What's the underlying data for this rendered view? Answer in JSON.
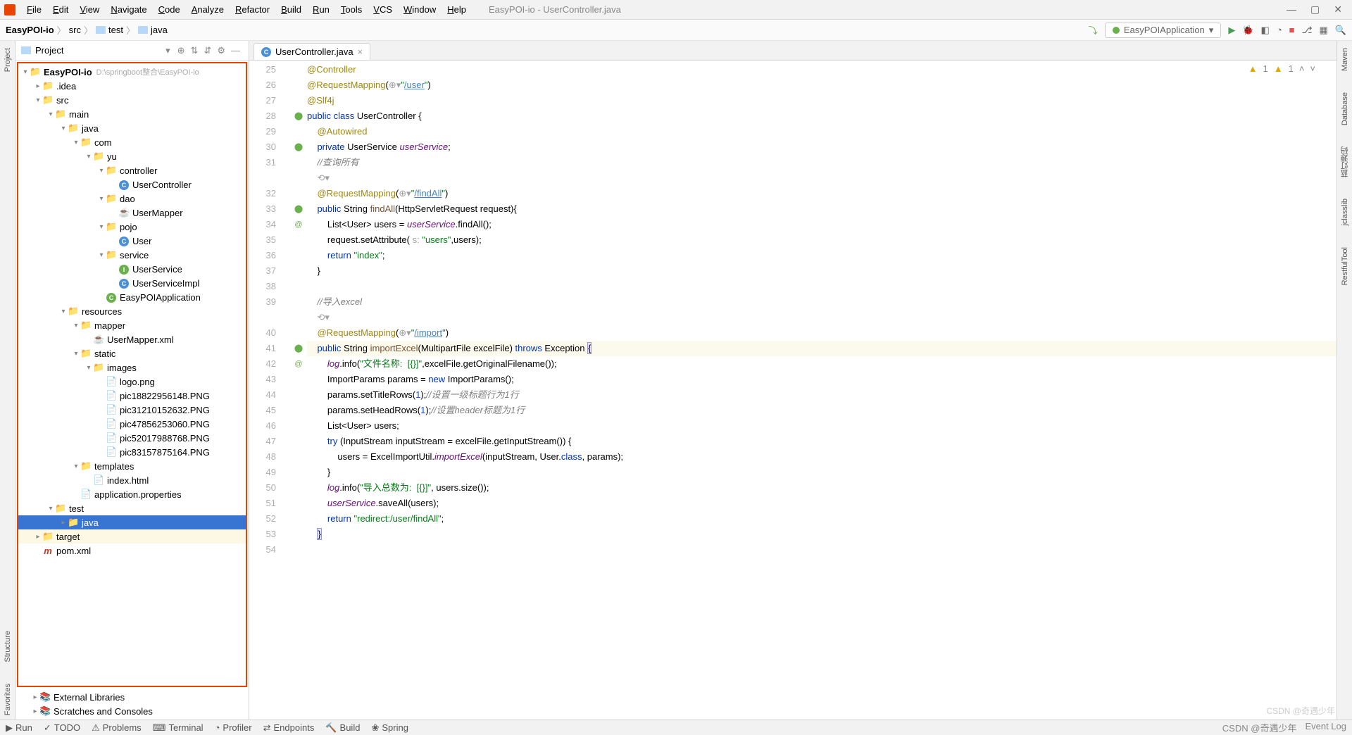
{
  "window_title": "EasyPOI-io - UserController.java",
  "menu": [
    "File",
    "Edit",
    "View",
    "Navigate",
    "Code",
    "Analyze",
    "Refactor",
    "Build",
    "Run",
    "Tools",
    "VCS",
    "Window",
    "Help"
  ],
  "breadcrumb": [
    "EasyPOI-io",
    "src",
    "test",
    "java"
  ],
  "run_config": "EasyPOIApplication",
  "project_panel_title": "Project",
  "tree": {
    "root_name": "EasyPOI-io",
    "root_path": "D:\\springboot整合\\EasyPOI-io",
    "items": [
      {
        "d": 1,
        "exp": ">",
        "ic": "folder",
        "label": ".idea"
      },
      {
        "d": 1,
        "exp": "v",
        "ic": "folder-blue",
        "label": "src"
      },
      {
        "d": 2,
        "exp": "v",
        "ic": "folder",
        "label": "main"
      },
      {
        "d": 3,
        "exp": "v",
        "ic": "folder-blue",
        "label": "java"
      },
      {
        "d": 4,
        "exp": "v",
        "ic": "folder",
        "label": "com"
      },
      {
        "d": 5,
        "exp": "v",
        "ic": "folder",
        "label": "yu"
      },
      {
        "d": 6,
        "exp": "v",
        "ic": "folder",
        "label": "controller"
      },
      {
        "d": 7,
        "exp": "",
        "ic": "class",
        "label": "UserController"
      },
      {
        "d": 6,
        "exp": "v",
        "ic": "folder",
        "label": "dao"
      },
      {
        "d": 7,
        "exp": "",
        "ic": "bean",
        "label": "UserMapper"
      },
      {
        "d": 6,
        "exp": "v",
        "ic": "folder",
        "label": "pojo"
      },
      {
        "d": 7,
        "exp": "",
        "ic": "class",
        "label": "User"
      },
      {
        "d": 6,
        "exp": "v",
        "ic": "folder",
        "label": "service"
      },
      {
        "d": 7,
        "exp": "",
        "ic": "iface",
        "label": "UserService"
      },
      {
        "d": 7,
        "exp": "",
        "ic": "class",
        "label": "UserServiceImpl"
      },
      {
        "d": 6,
        "exp": "",
        "ic": "class-run",
        "label": "EasyPOIApplication"
      },
      {
        "d": 3,
        "exp": "v",
        "ic": "folder",
        "label": "resources"
      },
      {
        "d": 4,
        "exp": "v",
        "ic": "folder",
        "label": "mapper"
      },
      {
        "d": 5,
        "exp": "",
        "ic": "bean",
        "label": "UserMapper.xml"
      },
      {
        "d": 4,
        "exp": "v",
        "ic": "folder",
        "label": "static"
      },
      {
        "d": 5,
        "exp": "v",
        "ic": "folder",
        "label": "images"
      },
      {
        "d": 6,
        "exp": "",
        "ic": "file",
        "label": "logo.png"
      },
      {
        "d": 6,
        "exp": "",
        "ic": "file",
        "label": "pic18822956148.PNG"
      },
      {
        "d": 6,
        "exp": "",
        "ic": "file",
        "label": "pic31210152632.PNG"
      },
      {
        "d": 6,
        "exp": "",
        "ic": "file",
        "label": "pic47856253060.PNG"
      },
      {
        "d": 6,
        "exp": "",
        "ic": "file",
        "label": "pic52017988768.PNG"
      },
      {
        "d": 6,
        "exp": "",
        "ic": "file",
        "label": "pic83157875164.PNG"
      },
      {
        "d": 4,
        "exp": "v",
        "ic": "folder",
        "label": "templates"
      },
      {
        "d": 5,
        "exp": "",
        "ic": "file",
        "label": "index.html"
      },
      {
        "d": 4,
        "exp": "",
        "ic": "file",
        "label": "application.properties"
      },
      {
        "d": 2,
        "exp": "v",
        "ic": "folder",
        "label": "test"
      },
      {
        "d": 3,
        "exp": ">",
        "ic": "folder-sel",
        "label": "java",
        "selected": true
      },
      {
        "d": 1,
        "exp": ">",
        "ic": "folder",
        "label": "target",
        "hover": true
      },
      {
        "d": 1,
        "exp": "",
        "ic": "maven",
        "label": "pom.xml"
      }
    ],
    "extra": [
      "External Libraries",
      "Scratches and Consoles"
    ]
  },
  "editor_tab": "UserController.java",
  "warnings": {
    "a": "1",
    "b": "1"
  },
  "code_lines": [
    {
      "n": 25,
      "html": "<span class='anno'>@Controller</span>"
    },
    {
      "n": 26,
      "html": "<span class='anno'>@RequestMapping</span>(<span class='param-hint'>⊕▾</span><span class='str'>\"</span><span class='link'>/user</span><span class='str'>\"</span>)"
    },
    {
      "n": 27,
      "html": "<span class='anno'>@Slf4j</span>"
    },
    {
      "n": 28,
      "gut": "⬤",
      "html": "<span class='kw'>public</span> <span class='kw'>class</span> UserController {"
    },
    {
      "n": 29,
      "html": "    <span class='anno'>@Autowired</span>"
    },
    {
      "n": 30,
      "gut": "⬤",
      "html": "    <span class='kw'>private</span> UserService <span class='field'>userService</span>;"
    },
    {
      "n": 31,
      "html": "    <span class='cmt-cn'>//查询所有</span>"
    },
    {
      "n": 0,
      "html": "    <span class='param-hint'>⟲▾</span>"
    },
    {
      "n": 32,
      "html": "    <span class='anno'>@RequestMapping</span>(<span class='param-hint'>⊕▾</span><span class='str'>\"</span><span class='link'>/findAll</span><span class='str'>\"</span>)"
    },
    {
      "n": 33,
      "gut": "⬤ @",
      "html": "    <span class='kw'>public</span> String <span class='method'>findAll</span>(HttpServletRequest request){"
    },
    {
      "n": 34,
      "html": "        List&lt;User&gt; users = <span class='field'>userService</span>.findAll();"
    },
    {
      "n": 35,
      "html": "        request.setAttribute( <span class='param-hint'>s:</span> <span class='str'>\"users\"</span>,users);"
    },
    {
      "n": 36,
      "html": "        <span class='kw'>return</span> <span class='str'>\"index\"</span>;"
    },
    {
      "n": 37,
      "html": "    }"
    },
    {
      "n": 38,
      "html": ""
    },
    {
      "n": 39,
      "html": "    <span class='cmt-cn'>//导入excel</span>"
    },
    {
      "n": 0,
      "html": "    <span class='param-hint'>⟲▾</span>"
    },
    {
      "n": 40,
      "html": "    <span class='anno'>@RequestMapping</span>(<span class='param-hint'>⊕▾</span><span class='str'>\"</span><span class='link'>/import</span><span class='str'>\"</span>)"
    },
    {
      "n": 41,
      "gut": "⬤ @",
      "hl": true,
      "html": "    <span class='kw'>public</span> String <span class='method'>importExcel</span>(MultipartFile excelFile) <span class='kw'>throws</span> Exception <span class='brace-hl'>{</span>"
    },
    {
      "n": 42,
      "html": "        <span class='field'>log</span>.info(<span class='str'>\"文件名称:  [{}]\"</span>,excelFile.getOriginalFilename());"
    },
    {
      "n": 43,
      "html": "        ImportParams params = <span class='kw'>new</span> ImportParams();"
    },
    {
      "n": 44,
      "html": "        params.setTitleRows(<span class='num'>1</span>);<span class='cmt-cn'>//设置一级标题行为1行</span>"
    },
    {
      "n": 45,
      "html": "        params.setHeadRows(<span class='num'>1</span>);<span class='cmt-cn'>//设置header标题为1行</span>"
    },
    {
      "n": 46,
      "html": "        List&lt;User&gt; users;"
    },
    {
      "n": 47,
      "html": "        <span class='kw'>try</span> (InputStream inputStream = excelFile.getInputStream()) {"
    },
    {
      "n": 48,
      "html": "            users = ExcelImportUtil.<span class='field'>importExcel</span>(inputStream, User.<span class='kw'>class</span>, params);"
    },
    {
      "n": 49,
      "html": "        }"
    },
    {
      "n": 50,
      "html": "        <span class='field'>log</span>.info(<span class='str'>\"导入总数为:  [{}]\"</span>, users.size());"
    },
    {
      "n": 51,
      "html": "        <span class='field'>userService</span>.saveAll(users);"
    },
    {
      "n": 52,
      "html": "        <span class='kw'>return</span> <span class='str'>\"redirect:/user/findAll\"</span>;"
    },
    {
      "n": 53,
      "html": "    <span class='brace-hl'>}</span>"
    },
    {
      "n": 54,
      "html": ""
    }
  ],
  "left_tabs": [
    "Project",
    "Structure",
    "Favorites"
  ],
  "right_tabs": [
    "Maven",
    "Database",
    "蓝灯源码",
    "jclasslib",
    "RestfulTool"
  ],
  "bottom_tools": [
    "Run",
    "TODO",
    "Problems",
    "Terminal",
    "Profiler",
    "Endpoints",
    "Build",
    "Spring"
  ],
  "status_right": [
    "CSDN @奇遇少年",
    "Event Log"
  ],
  "watermark": "CSDN @奇遇少年"
}
